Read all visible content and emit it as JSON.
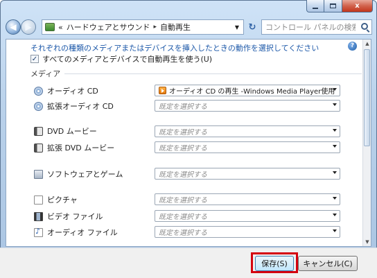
{
  "window": {
    "caption": {
      "close_glyph": "x"
    }
  },
  "address_bar": {
    "overflow_chevron": "«",
    "breadcrumbs": [
      "ハードウェアとサウンド",
      "自動再生"
    ],
    "separator": "▸"
  },
  "search": {
    "placeholder": "コントロール パネルの検索"
  },
  "content": {
    "intro_text": "それぞれの種類のメディアまたはデバイスを挿入したときの動作を選択してください",
    "use_all_checkbox": {
      "label": "すべてのメディアとデバイスで自動再生を使う(U)",
      "checked": true,
      "check_glyph": "✓"
    },
    "media_group_label": "メディア",
    "rows": [
      {
        "label": "オーディオ CD",
        "icon": "cd-icon",
        "value": "オーディオ CD の再生 -Windows Media Player使用",
        "is_placeholder": false
      },
      {
        "label": "拡張オーディオ CD",
        "icon": "cd-icon",
        "value": "既定を選択する",
        "is_placeholder": true
      },
      {
        "label": "DVD ムービー",
        "icon": "dvd-icon",
        "value": "既定を選択する",
        "is_placeholder": true
      },
      {
        "label": "拡張 DVD ムービー",
        "icon": "dvd-icon",
        "value": "既定を選択する",
        "is_placeholder": true
      },
      {
        "label": "ソフトウェアとゲーム",
        "icon": "game-icon",
        "value": "既定を選択する",
        "is_placeholder": true
      },
      {
        "label": "ピクチャ",
        "icon": "picture-icon",
        "value": "既定を選択する",
        "is_placeholder": true
      },
      {
        "label": "ビデオ ファイル",
        "icon": "video-file-icon",
        "value": "既定を選択する",
        "is_placeholder": true
      },
      {
        "label": "オーディオ ファイル",
        "icon": "audio-file-icon",
        "value": "既定を選択する",
        "is_placeholder": true
      }
    ]
  },
  "footer": {
    "save_label": "保存(S)",
    "cancel_label": "キャンセル(C)"
  },
  "colors": {
    "accent_link": "#1b57a8",
    "highlight_box": "#d4000f"
  }
}
